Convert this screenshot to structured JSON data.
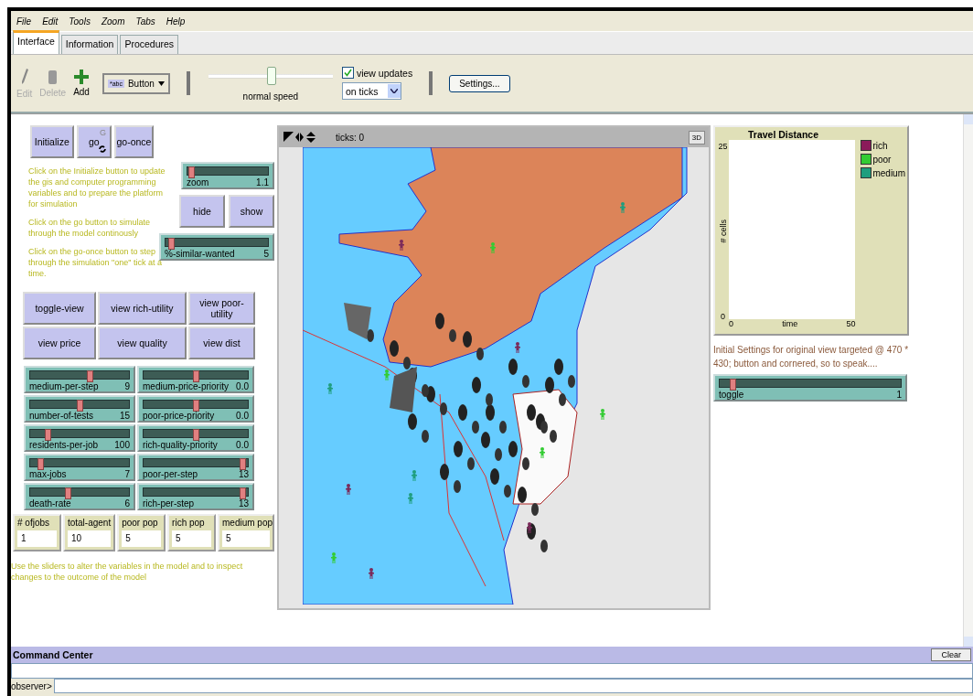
{
  "menu": [
    "File",
    "Edit",
    "Tools",
    "Zoom",
    "Tabs",
    "Help"
  ],
  "tabs": [
    {
      "label": "Interface",
      "selected": true
    },
    {
      "label": "Information",
      "selected": false
    },
    {
      "label": "Procedures",
      "selected": false
    }
  ],
  "toolbar": {
    "tools": [
      {
        "kind": "edit",
        "label": "Edit",
        "disabled": true
      },
      {
        "kind": "delete",
        "label": "Delete",
        "disabled": true
      },
      {
        "kind": "add",
        "label": "Add",
        "disabled": false
      }
    ],
    "widget_icon": "*abc",
    "widget_choice": "Button",
    "speed": {
      "level": 0.5,
      "label": "normal speed"
    },
    "view_updates": {
      "label": "view updates",
      "checked": true
    },
    "update_mode": "on ticks",
    "settings": "Settings..."
  },
  "top_buttons": [
    {
      "label": "Initialize",
      "forever": false
    },
    {
      "label": "go",
      "forever": true,
      "key": "G"
    },
    {
      "label": "go-once",
      "forever": false
    }
  ],
  "notes_left": [
    "Click on the Initialize button to update the gis and computer programming variables and to prepare the platform for simulation",
    "Click on the go button to simulate through the model continously",
    "Click on the go-once button to step through the simulation \"one\" tick at a time."
  ],
  "zoom_slider": {
    "name": "zoom",
    "value": "1.1",
    "level": 0.05
  },
  "view_buttons_small": [
    "hide",
    "show"
  ],
  "similar_slider": {
    "name": "%-similar-wanted",
    "value": "5",
    "level": 0.05
  },
  "view_buttons": [
    "toggle-view",
    "view rich-utility",
    "view poor-utility",
    "view price",
    "view quality",
    "view dist"
  ],
  "sliders": [
    {
      "name": "medium-per-step",
      "value": "9",
      "level": 0.6
    },
    {
      "name": "medium-price-priority",
      "value": "0.0",
      "level": 0.5
    },
    {
      "name": "number-of-tests",
      "value": "15",
      "level": 0.5
    },
    {
      "name": "poor-price-priority",
      "value": "0.0",
      "level": 0.5
    },
    {
      "name": "residents-per-job",
      "value": "100",
      "level": 0.18
    },
    {
      "name": "rich-quality-priority",
      "value": "0.0",
      "level": 0.5
    },
    {
      "name": "max-jobs",
      "value": "7",
      "level": 0.1
    },
    {
      "name": "poor-per-step",
      "value": "13",
      "level": 0.95
    },
    {
      "name": "death-rate",
      "value": "6",
      "level": 0.38
    },
    {
      "name": "rich-per-step",
      "value": "13",
      "level": 0.95
    }
  ],
  "monitors": [
    {
      "label": "# ofjobs",
      "value": "1"
    },
    {
      "label": "total-agent",
      "value": "10"
    },
    {
      "label": "poor pop",
      "value": "5"
    },
    {
      "label": "rich pop",
      "value": "5"
    },
    {
      "label": "medium pop",
      "value": "5"
    }
  ],
  "note_bottom": "Use the sliders to alter the variables in the model and to inspect changes to the outcome of the model",
  "view": {
    "ticks": "ticks: 0",
    "three_d": "3D"
  },
  "plot": {
    "title": "Travel Distance",
    "x_label": "time",
    "y_label": "# cells",
    "x_min": "0",
    "x_max": "50",
    "y_min": "0",
    "y_max": "25",
    "legend": [
      {
        "name": "rich",
        "color": "#8b1a5a"
      },
      {
        "name": "poor",
        "color": "#33cc33"
      },
      {
        "name": "medium",
        "color": "#1f9e7e"
      }
    ]
  },
  "note_right": "Initial Settings for original view targeted @ 470 * 430; button and cornered, so to speak....",
  "toggle_slider": {
    "name": "toggle",
    "value": "1",
    "level": 0.07
  },
  "command_center": {
    "title": "Command Center",
    "clear": "Clear",
    "prompt": "observer>"
  }
}
